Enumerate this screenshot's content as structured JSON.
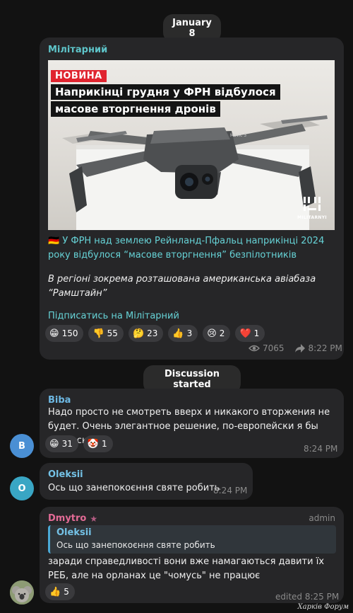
{
  "date_pill": "January 8",
  "post": {
    "channel": "Мілітарний",
    "image": {
      "badge": "НОВИНА",
      "headline_line1": "Наприкінці грудня у ФРН відбулося",
      "headline_line2": "масове вторгнення дронів",
      "drone_model": "Mavic 3",
      "watermark": "MILITARNYI"
    },
    "text1": "🇩🇪 У ФРН над землею Рейнланд-Пфальц наприкінці 2024 року відбулося “масове вторгнення” безпілотників",
    "text2": "В регіоні зокрема розташована американська авіабаза “Рамштайн”",
    "subscribe": "Підписатись на Мілітарний",
    "reactions": [
      {
        "emoji": "😁",
        "count": "150"
      },
      {
        "emoji": "👎",
        "count": "55"
      },
      {
        "emoji": "🤔",
        "count": "23"
      },
      {
        "emoji": "👍",
        "count": "3"
      },
      {
        "emoji": "😢",
        "count": "2"
      },
      {
        "emoji": "❤️",
        "count": "1"
      }
    ],
    "views": "7065",
    "time": "8:22 PM"
  },
  "discussion_pill": "Discussion started",
  "msg1": {
    "sender": "Biba",
    "avatar_letter": "B",
    "text": "Надо просто не смотреть вверх и никакого вторжения не будет. Очень элегантное решение, по-европейски я бы даже сказал",
    "reactions": [
      {
        "emoji": "😁",
        "count": "31"
      },
      {
        "emoji": "🤡",
        "count": "1"
      }
    ],
    "time": "8:24 PM"
  },
  "msg2": {
    "sender": "Oleksii",
    "avatar_letter": "O",
    "text": "Ось що занепокоєння святе робить",
    "time": "8:24 PM"
  },
  "msg3": {
    "sender": "Dmytro",
    "role": "admin",
    "reply_sender": "Oleksii",
    "reply_text": "Ось що занепокоєння святе робить",
    "text": "заради справедливості вони вже намагаються давити їх РЕБ, але на орланах це \"чомусь\" не працює",
    "reactions": [
      {
        "emoji": "👍",
        "count": "5"
      }
    ],
    "time": "edited 8:25 PM"
  },
  "corner_watermark": "Харків Форум",
  "colors": {
    "background": "#121212",
    "bubble": "#262628",
    "channel_name": "#5ec4c9",
    "link": "#66d2d6",
    "biba": "#6db8e3",
    "oleksii": "#74c2e6",
    "dmytro": "#e36b96",
    "reply_bar": "#4ba9d6",
    "heart": "#e0242f"
  }
}
